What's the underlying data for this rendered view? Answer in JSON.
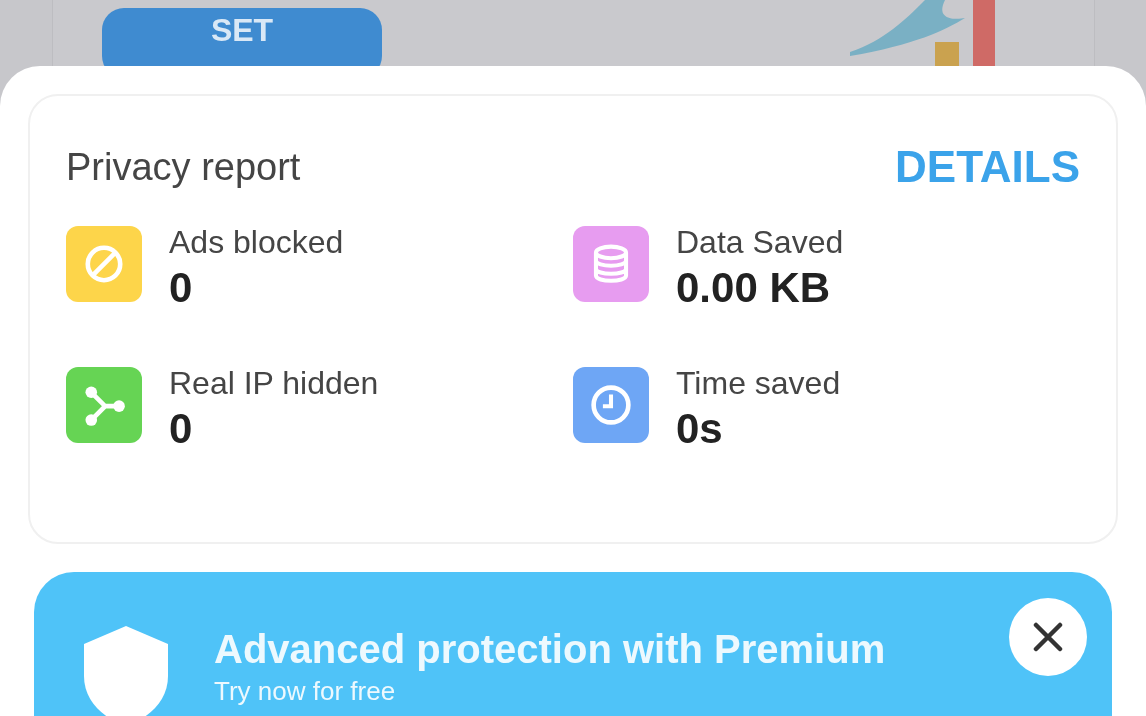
{
  "background": {
    "button": "SET"
  },
  "privacy_report": {
    "title": "Privacy report",
    "action": "DETAILS",
    "stats": [
      {
        "kind": "ads",
        "label": "Ads blocked",
        "value": "0",
        "color": "#fdd54a"
      },
      {
        "kind": "data",
        "label": "Data Saved",
        "value": "0.00 KB",
        "color": "#e79cf0"
      },
      {
        "kind": "ip",
        "label": "Real IP hidden",
        "value": "0",
        "color": "#66d454"
      },
      {
        "kind": "time",
        "label": "Time saved",
        "value": "0s",
        "color": "#6ea6f5"
      }
    ]
  },
  "premium_banner": {
    "title": "Advanced protection with Premium",
    "subtitle": "Try now for free"
  }
}
